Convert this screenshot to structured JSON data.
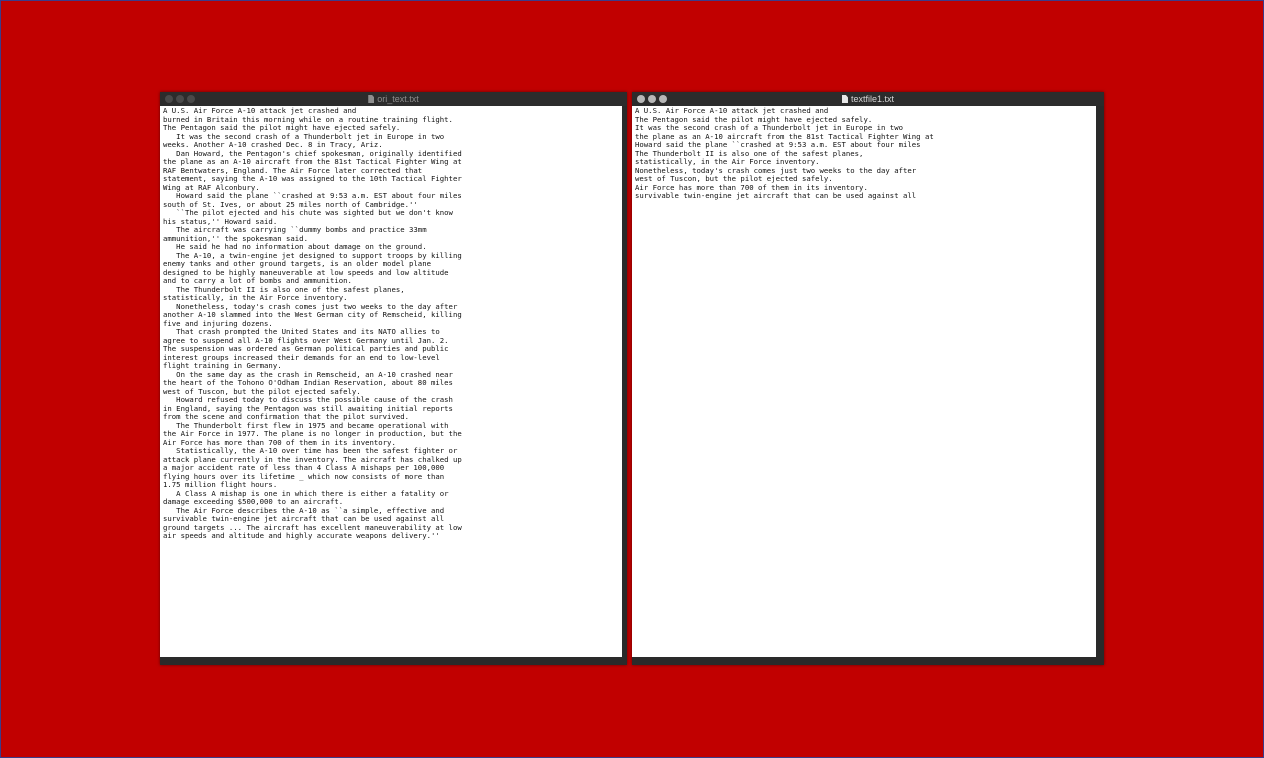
{
  "windows": {
    "left": {
      "title": "ori_text.txt",
      "lines": [
        "A U.S. Air Force A-10 attack jet crashed and",
        "burned in Britain this morning while on a routine training flight.",
        "The Pentagon said the pilot might have ejected safely.",
        "   It was the second crash of a Thunderbolt jet in Europe in two",
        "weeks. Another A-10 crashed Dec. 8 in Tracy, Ariz.",
        "   Dan Howard, the Pentagon's chief spokesman, originally identified",
        "the plane as an A-10 aircraft from the 81st Tactical Fighter Wing at",
        "RAF Bentwaters, England. The Air Force later corrected that",
        "statement, saying the A-10 was assigned to the 10th Tactical Fighter",
        "Wing at RAF Alconbury.",
        "   Howard said the plane ``crashed at 9:53 a.m. EST about four miles",
        "south of St. Ives, or about 25 miles north of Cambridge.''",
        "   ``The pilot ejected and his chute was sighted but we don't know",
        "his status,'' Howard said.",
        "   The aircraft was carrying ``dummy bombs and practice 33mm",
        "ammunition,'' the spokesman said.",
        "   He said he had no information about damage on the ground.",
        "   The A-10, a twin-engine jet designed to support troops by killing",
        "enemy tanks and other ground targets, is an older model plane",
        "designed to be highly maneuverable at low speeds and low altitude",
        "and to carry a lot of bombs and ammunition.",
        "   The Thunderbolt II is also one of the safest planes,",
        "statistically, in the Air Force inventory.",
        "   Nonetheless, today's crash comes just two weeks to the day after",
        "another A-10 slammed into the West German city of Remscheid, killing",
        "five and injuring dozens.",
        "   That crash prompted the United States and its NATO allies to",
        "agree to suspend all A-10 flights over West Germany until Jan. 2.",
        "The suspension was ordered as German political parties and public",
        "interest groups increased their demands for an end to low-level",
        "flight training in Germany.",
        "   On the same day as the crash in Remscheid, an A-10 crashed near",
        "the heart of the Tohono O'Odham Indian Reservation, about 80 miles",
        "west of Tuscon, but the pilot ejected safely.",
        "   Howard refused today to discuss the possible cause of the crash",
        "in England, saying the Pentagon was still awaiting initial reports",
        "from the scene and confirmation that the pilot survived.",
        "   The Thunderbolt first flew in 1975 and became operational with",
        "the Air Force in 1977. The plane is no longer in production, but the",
        "Air Force has more than 700 of them in its inventory.",
        "   Statistically, the A-10 over time has been the safest fighter or",
        "attack plane currently in the inventory. The aircraft has chalked up",
        "a major accident rate of less than 4 Class A mishaps per 100,000",
        "flying hours over its lifetime _ which now consists of more than",
        "1.75 million flight hours.",
        "   A Class A mishap is one in which there is either a fatality or",
        "damage exceeding $500,000 to an aircraft.",
        "   The Air Force describes the A-10 as ``a simple, effective and",
        "survivable twin-engine jet aircraft that can be used against all",
        "ground targets ... The aircraft has excellent maneuverability at low",
        "air speeds and altitude and highly accurate weapons delivery.''"
      ]
    },
    "right": {
      "title": "textfile1.txt",
      "lines": [
        "A U.S. Air Force A-10 attack jet crashed and",
        "The Pentagon said the pilot might have ejected safely.",
        "It was the second crash of a Thunderbolt jet in Europe in two",
        "the plane as an A-10 aircraft from the 81st Tactical Fighter Wing at",
        "Howard said the plane ``crashed at 9:53 a.m. EST about four miles",
        "The Thunderbolt II is also one of the safest planes,",
        "statistically, in the Air Force inventory.",
        "Nonetheless, today's crash comes just two weeks to the day after",
        "west of Tuscon, but the pilot ejected safely.",
        "Air Force has more than 700 of them in its inventory.",
        "survivable twin-engine jet aircraft that can be used against all"
      ]
    }
  }
}
